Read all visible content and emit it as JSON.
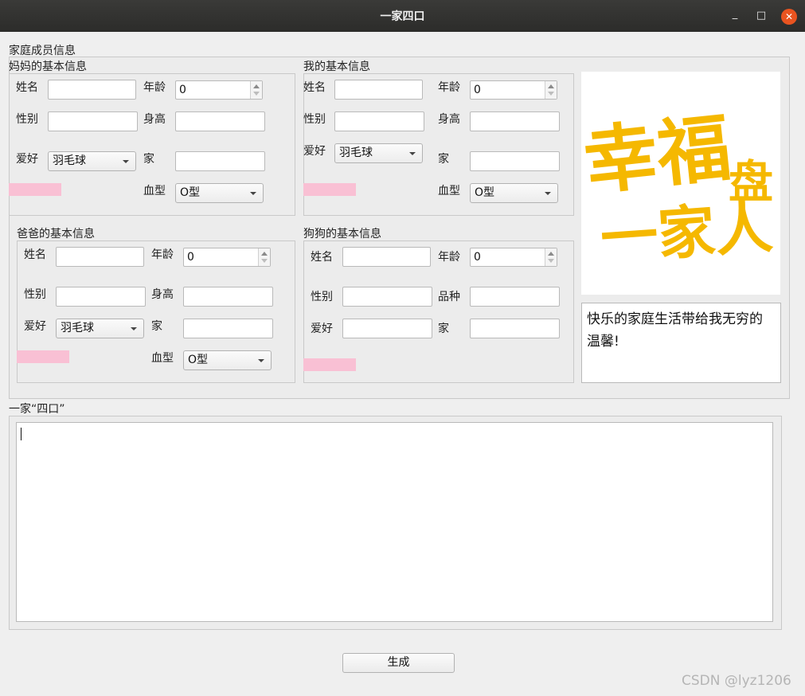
{
  "window": {
    "title": "一家四口",
    "minimize_glyph": "_",
    "maximize_glyph": "□",
    "close_glyph": "✕"
  },
  "members_group": {
    "title": "家庭成员信息"
  },
  "mom": {
    "title": "妈妈的基本信息",
    "name_label": "姓名",
    "name_value": "",
    "age_label": "年龄",
    "age_value": "0",
    "gender_label": "性别",
    "gender_value": "",
    "height_label": "身高",
    "height_value": "",
    "hobby_label": "爱好",
    "hobby_value": "羽毛球",
    "home_label": "家",
    "home_value": "",
    "blood_label": "血型",
    "blood_value": "O型"
  },
  "me": {
    "title": "我的基本信息",
    "name_label": "姓名",
    "name_value": "",
    "age_label": "年龄",
    "age_value": "0",
    "gender_label": "性别",
    "gender_value": "",
    "height_label": "身高",
    "height_value": "",
    "hobby_label": "爱好",
    "hobby_value": "羽毛球",
    "home_label": "家",
    "home_value": "",
    "blood_label": "血型",
    "blood_value": "O型"
  },
  "dad": {
    "title": "爸爸的基本信息",
    "name_label": "姓名",
    "name_value": "",
    "age_label": "年龄",
    "age_value": "0",
    "gender_label": "性别",
    "gender_value": "",
    "height_label": "身高",
    "height_value": "",
    "hobby_label": "爱好",
    "hobby_value": "羽毛球",
    "home_label": "家",
    "home_value": "",
    "blood_label": "血型",
    "blood_value": "O型"
  },
  "dog": {
    "title": "狗狗的基本信息",
    "name_label": "姓名",
    "name_value": "",
    "age_label": "年龄",
    "age_value": "0",
    "gender_label": "性别",
    "gender_value": "",
    "breed_label": "品种",
    "breed_value": "",
    "hobby_label": "爱好",
    "hobby_value": "",
    "home_label": "家",
    "home_value": ""
  },
  "banner": {
    "line1": "幸福",
    "line2": "一家人",
    "house": "盘",
    "color": "#f5b800"
  },
  "message": "快乐的家庭生活带给我无穷的温馨!",
  "family_group": {
    "title": "一家“四口”",
    "content": ""
  },
  "generate_button": "生成",
  "watermark": "CSDN @lyz1206",
  "colors": {
    "titlebar": "#2c2c2a",
    "close_button": "#e95420",
    "pink_tag": "#f9c0d4",
    "window_bg": "#efefef"
  }
}
